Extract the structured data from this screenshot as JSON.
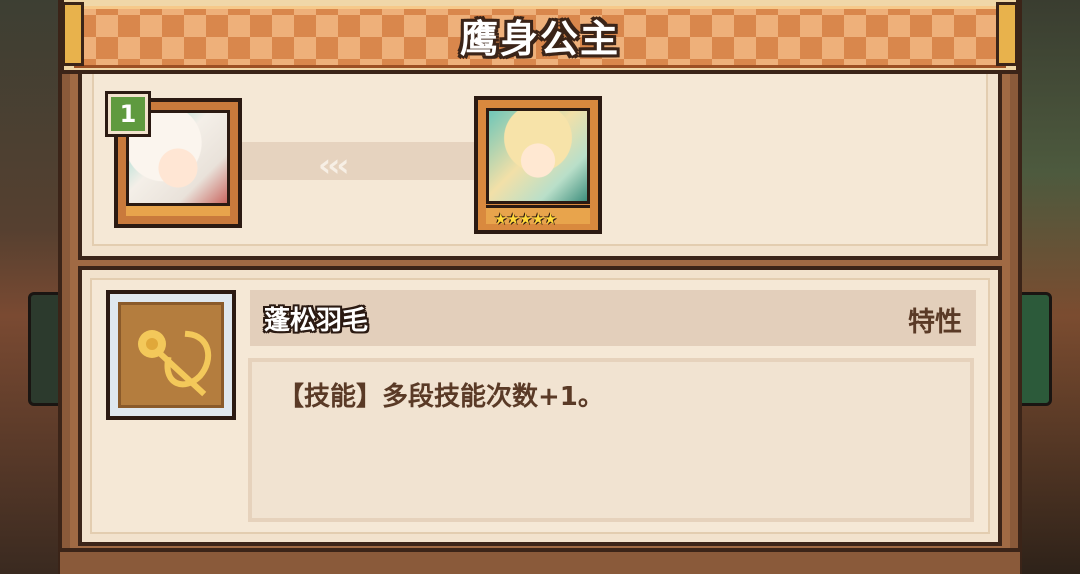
{
  "title": "鹰身公主",
  "evolution": {
    "from": {
      "rank": "1",
      "name_icon": "character-portrait-white-hair"
    },
    "to": {
      "stars": "★★★★★",
      "name_icon": "character-portrait-blonde-hair"
    },
    "arrow_glyphs": "‹‹‹"
  },
  "skill": {
    "icon": "feather-spear-icon",
    "name": "蓬松羽毛",
    "type": "特性",
    "description": "【技能】多段技能次数+1。"
  },
  "colors": {
    "banner": "#d9874c",
    "panel": "#f2e2cd",
    "outline": "#3b2418",
    "text_dark": "#5a3a26",
    "rank_badge": "#5f9a3f",
    "star": "#ffd83a"
  }
}
